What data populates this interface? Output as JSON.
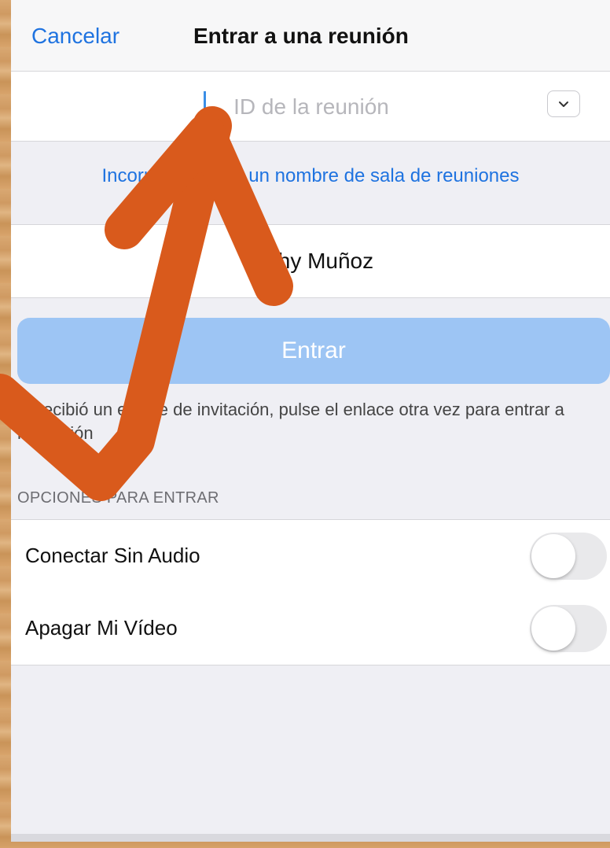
{
  "navbar": {
    "cancel_label": "Cancelar",
    "title": "Entrar a una reunión"
  },
  "meeting_id": {
    "placeholder": "ID de la reunión",
    "value": "",
    "dropdown_icon": "chevron-down-icon"
  },
  "room_link": "Incorporarse con un nombre de sala de reuniones",
  "display_name": "Kishy Muñoz",
  "enter_button": "Entrar",
  "hint": "Si recibió un enlace de invitación, pulse el enlace otra vez para entrar a la reunión",
  "options": {
    "section_title": "OPCIONES PARA ENTRAR",
    "items": [
      {
        "label": "Conectar Sin Audio",
        "enabled": false
      },
      {
        "label": "Apagar Mi Vídeo",
        "enabled": false
      }
    ]
  },
  "colors": {
    "accent": "#1f73e0",
    "button_disabled": "#9dc5f4",
    "annotation_arrow": "#d95a1c"
  }
}
